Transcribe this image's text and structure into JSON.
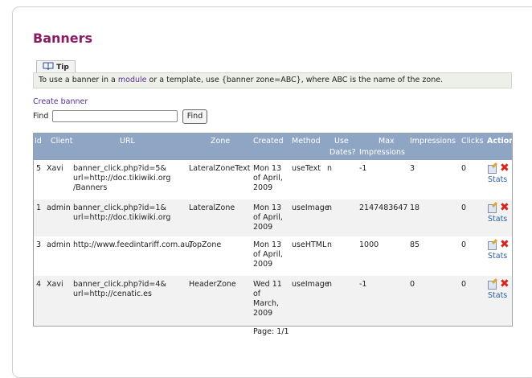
{
  "title": "Banners",
  "tip": {
    "tab_label": "Tip",
    "text_before": "To use a banner in a ",
    "module_link": "module",
    "text_after": " or a template, use {banner zone=ABC}, where ABC is the name of the zone."
  },
  "create_banner": "Create banner",
  "find": {
    "label": "Find",
    "value": "",
    "button": "Find"
  },
  "table": {
    "headers": {
      "id": "Id",
      "client": "Client",
      "url": "URL",
      "zone": "Zone",
      "created": "Created",
      "method": "Method",
      "use_dates_1": "Use",
      "use_dates_2": "Dates?",
      "max_impressions_1": "Max",
      "max_impressions_2": "Impressions",
      "impressions": "Impressions",
      "clicks": "Clicks",
      "action": "Action"
    },
    "rows": [
      {
        "id": "5",
        "client": "Xavi",
        "url_line1": "banner_click.php?id=5&",
        "url_line2": "url=http://doc.tikiwiki.org",
        "url_line3": "/Banners",
        "zone": "LateralZoneText",
        "created_line1": "Mon 13",
        "created_line2": "of April,",
        "created_line3": "2009",
        "created_line4": "",
        "method": "useText",
        "use_dates": "n",
        "max_impressions": "-1",
        "impressions": "3",
        "clicks": "0",
        "stats_label": "Stats"
      },
      {
        "id": "1",
        "client": "admin",
        "url_line1": "banner_click.php?id=1&",
        "url_line2": "url=http://doc.tikiwiki.org",
        "url_line3": "",
        "zone": "LateralZone",
        "created_line1": "Mon 13",
        "created_line2": "of April,",
        "created_line3": "2009",
        "created_line4": "",
        "method": "useImage",
        "use_dates": "n",
        "max_impressions": "2147483647",
        "impressions": "18",
        "clicks": "0",
        "stats_label": "Stats"
      },
      {
        "id": "3",
        "client": "admin",
        "url_line1": "http://www.feedintariff.com.au/",
        "url_line2": "",
        "url_line3": "",
        "zone": "TopZone",
        "created_line1": "Mon 13",
        "created_line2": "of April,",
        "created_line3": "2009",
        "created_line4": "",
        "method": "useHTML",
        "use_dates": "n",
        "max_impressions": "1000",
        "impressions": "85",
        "clicks": "0",
        "stats_label": "Stats"
      },
      {
        "id": "4",
        "client": "Xavi",
        "url_line1": "banner_click.php?id=4&",
        "url_line2": "url=http://cenatic.es",
        "url_line3": "",
        "zone": "HeaderZone",
        "created_line1": "Wed 11",
        "created_line2": "of",
        "created_line3": "March,",
        "created_line4": "2009",
        "method": "useImage",
        "use_dates": "n",
        "max_impressions": "-1",
        "impressions": "0",
        "clicks": "0",
        "stats_label": "Stats"
      }
    ]
  },
  "pager": "Page: 1/1"
}
